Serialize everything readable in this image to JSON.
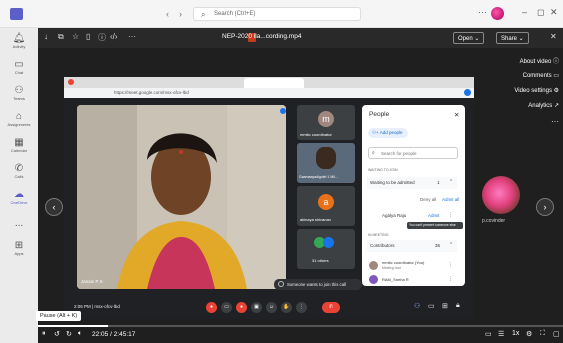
{
  "teams": {
    "search_placeholder": "Search (Ctrl+E)",
    "rail": [
      {
        "label": "Activity",
        "icon": "bell-icon"
      },
      {
        "label": "Chat",
        "icon": "chat-icon"
      },
      {
        "label": "Teams",
        "icon": "teams-icon"
      },
      {
        "label": "Assignments",
        "icon": "assignments-icon"
      },
      {
        "label": "Calendar",
        "icon": "calendar-icon"
      },
      {
        "label": "Calls",
        "icon": "phone-icon"
      },
      {
        "label": "OneDrive",
        "icon": "cloud-icon"
      },
      {
        "label": "...",
        "icon": "more-icon"
      },
      {
        "label": "Apps",
        "icon": "apps-icon"
      }
    ]
  },
  "viewer": {
    "file_title": "NEP-2020 lla...cording.mp4",
    "open_label": "Open",
    "share_label": "Share",
    "side_menu": [
      "About video",
      "Comments",
      "Video settings",
      "Analytics"
    ],
    "right_thumb_label": "p.covinder"
  },
  "recording": {
    "address": "https://meet.google.com/msx-ofcv-lbd",
    "speaker_name": "Janani P S",
    "meeting_code": "2:05 PM | msx-ofcv-lbd",
    "join_notice": "Someone wants to join this call",
    "tiles": [
      {
        "letter": "m",
        "name": "mmitc coordinator",
        "color": "#a1887f"
      },
      {
        "letter": "",
        "name": "Gaamaayadigolet 1 Mil...",
        "color": "#5a6a7a"
      },
      {
        "letter": "a",
        "name": "akinaya shivanan",
        "color": "#e8711a"
      },
      {
        "letter": "",
        "name": "31 others",
        "color": "#3c4043"
      }
    ],
    "people": {
      "title": "People",
      "add_people": "Add people",
      "search_placeholder": "Search for people",
      "waiting_header": "WAITING TO JOIN",
      "waiting_label": "Waiting to be admitted",
      "waiting_count": "1",
      "deny_all": "Deny all",
      "admit_all": "Admit all",
      "person_waiting": "Agalya Raju",
      "admit": "Admit",
      "tooltip": "You can't present someone else",
      "in_meeting_header": "IN MEETING",
      "contributors_label": "Contributors",
      "contributors_count": "36",
      "members": [
        {
          "name": "mmitc coordinator (You)",
          "sub": "Meeting host"
        },
        {
          "name": "RAM_Sneha R",
          "sub": ""
        }
      ]
    }
  },
  "player": {
    "tooltip": "Pause (Alt + K)",
    "time": "22:05 / 2:45:17",
    "progress": 0.1337
  }
}
